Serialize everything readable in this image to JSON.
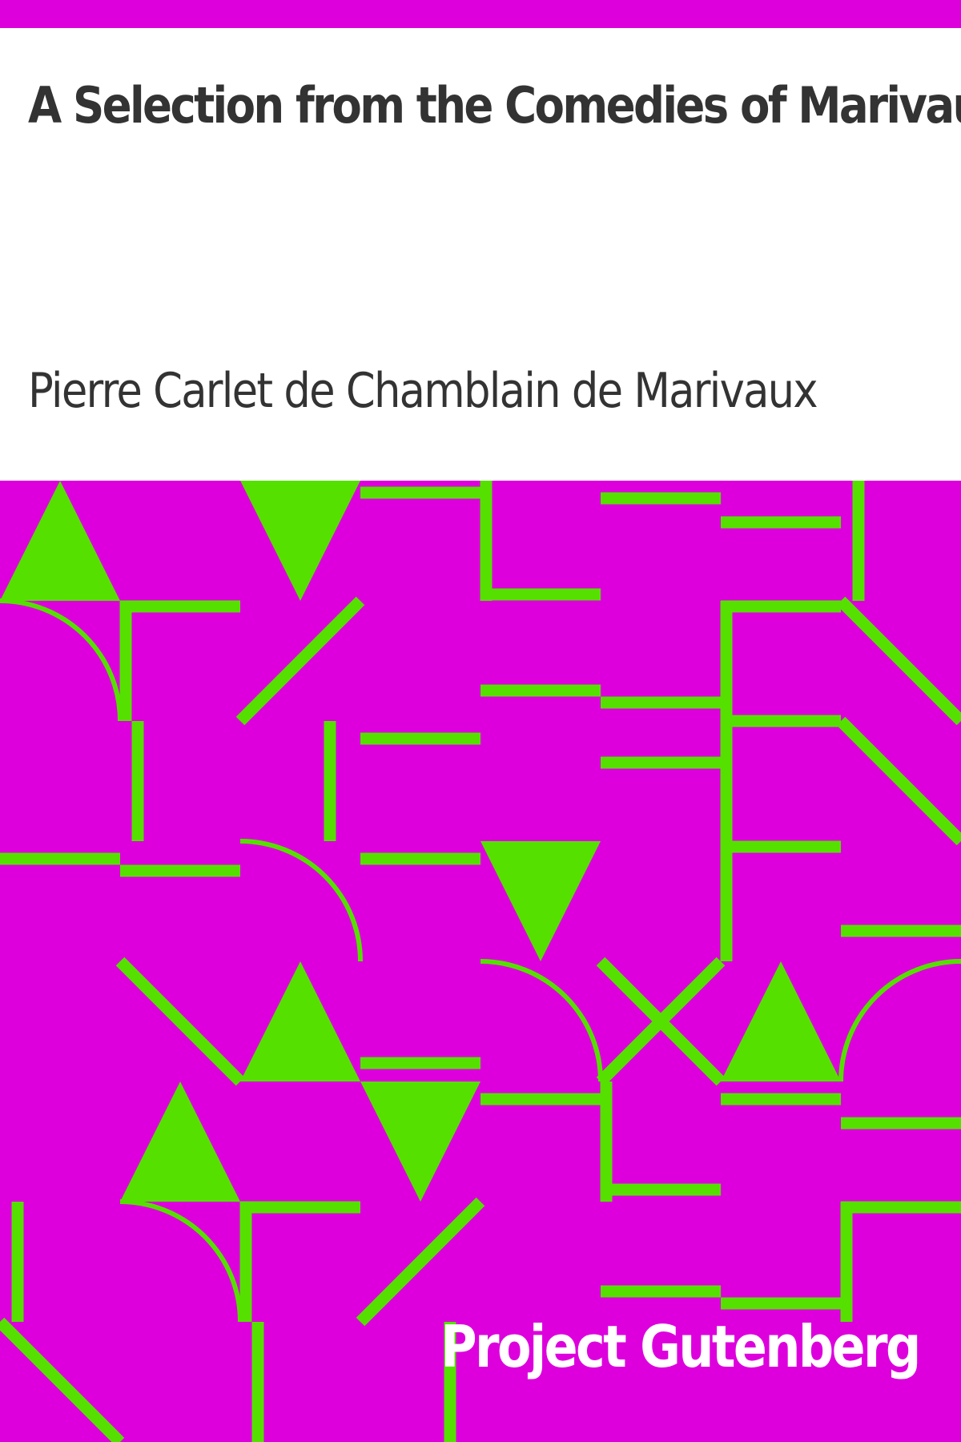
{
  "book": {
    "title": "A Selection from the Comedies of Marivaux",
    "author": "Pierre Carlet de Chamblain de Marivaux",
    "publisher": "Project Gutenberg"
  },
  "colors": {
    "background": "#ffffff",
    "band": "#dd00dd",
    "pattern_background": "#dd00dd",
    "pattern_foreground": "#55e000",
    "text": "#333333",
    "publisher_text": "#ffffff"
  }
}
